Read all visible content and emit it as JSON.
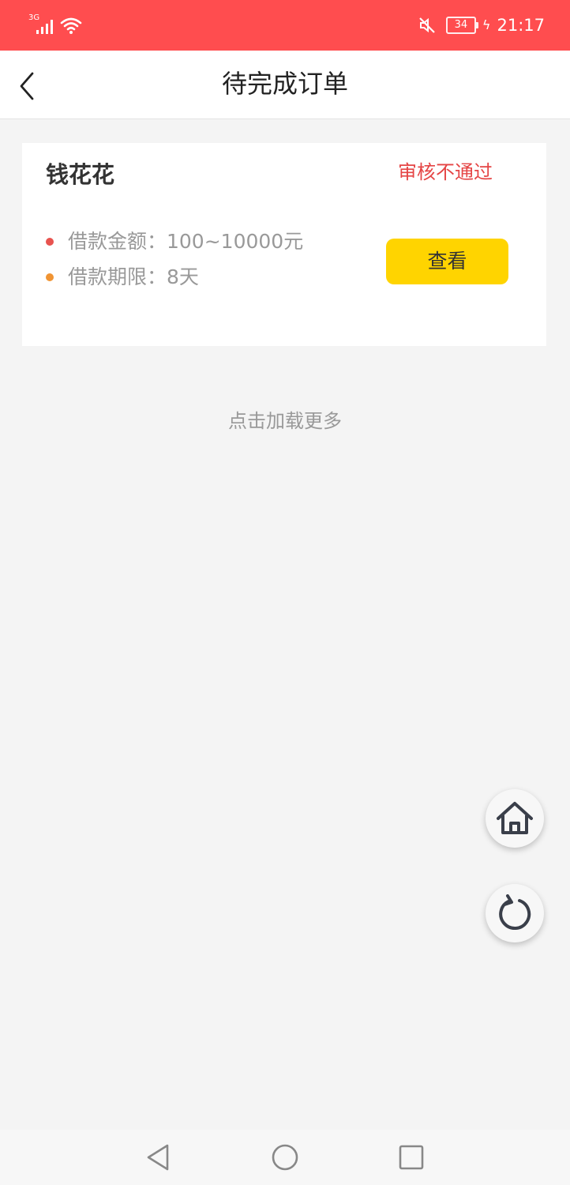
{
  "status_bar": {
    "network": "3G",
    "battery": "34",
    "time": "21:17"
  },
  "header": {
    "title": "待完成订单"
  },
  "order": {
    "product_name": "钱花花",
    "status": "审核不通过",
    "status_color": "#e54545",
    "amount_label": "借款金额：100~10000元",
    "term_label": "借款期限：8天",
    "amount_dot_color": "#e8534f",
    "term_dot_color": "#f09433",
    "view_button_label": "查看",
    "view_button_color": "#ffd400"
  },
  "load_more": "点击加载更多",
  "floating": {
    "home_icon": "home-icon",
    "refresh_icon": "refresh-icon"
  },
  "nav_bar": {
    "icons": [
      "back-triangle-icon",
      "home-circle-icon",
      "recent-square-icon"
    ]
  },
  "colors": {
    "status_bar": "#ff4d4f",
    "background": "#f4f4f4"
  }
}
